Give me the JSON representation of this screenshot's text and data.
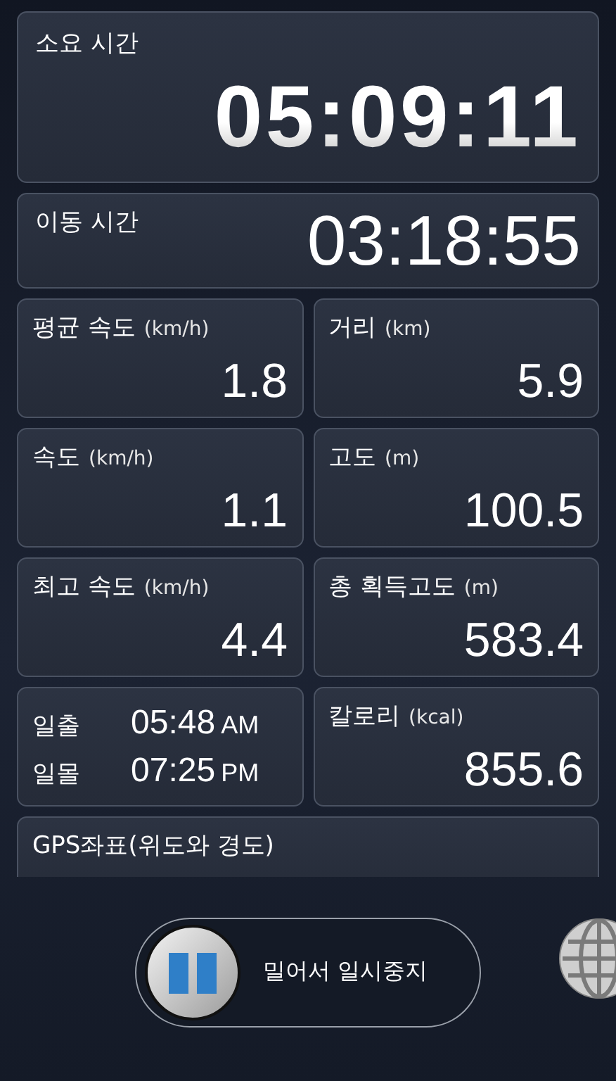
{
  "total_time": {
    "label": "소요 시간",
    "value": "05:09:11"
  },
  "moving_time": {
    "label": "이동 시간",
    "value": "03:18:55"
  },
  "stats": [
    {
      "kind": "metric",
      "label": "평균 속도",
      "unit": "(km/h)",
      "value": "1.8"
    },
    {
      "kind": "metric",
      "label": "거리",
      "unit": "(km)",
      "value": "5.9"
    },
    {
      "kind": "metric",
      "label": "속도",
      "unit": "(km/h)",
      "value": "1.1"
    },
    {
      "kind": "metric",
      "label": "고도",
      "unit": "(m)",
      "value": "100.5"
    },
    {
      "kind": "metric",
      "label": "최고 속도",
      "unit": "(km/h)",
      "value": "4.4"
    },
    {
      "kind": "metric",
      "label": "총 획득고도",
      "unit": "(m)",
      "value": "583.4"
    },
    {
      "kind": "sun",
      "rows": [
        {
          "label": "일출",
          "time": "05:48",
          "period": "AM"
        },
        {
          "label": "일몰",
          "time": "07:25",
          "period": "PM"
        }
      ]
    },
    {
      "kind": "metric",
      "label": "칼로리",
      "unit": "(kcal)",
      "value": "855.6"
    }
  ],
  "gps": {
    "label": "GPS좌표(위도와 경도)"
  },
  "slider": {
    "label": "밀어서 일시중지",
    "level": 0
  }
}
